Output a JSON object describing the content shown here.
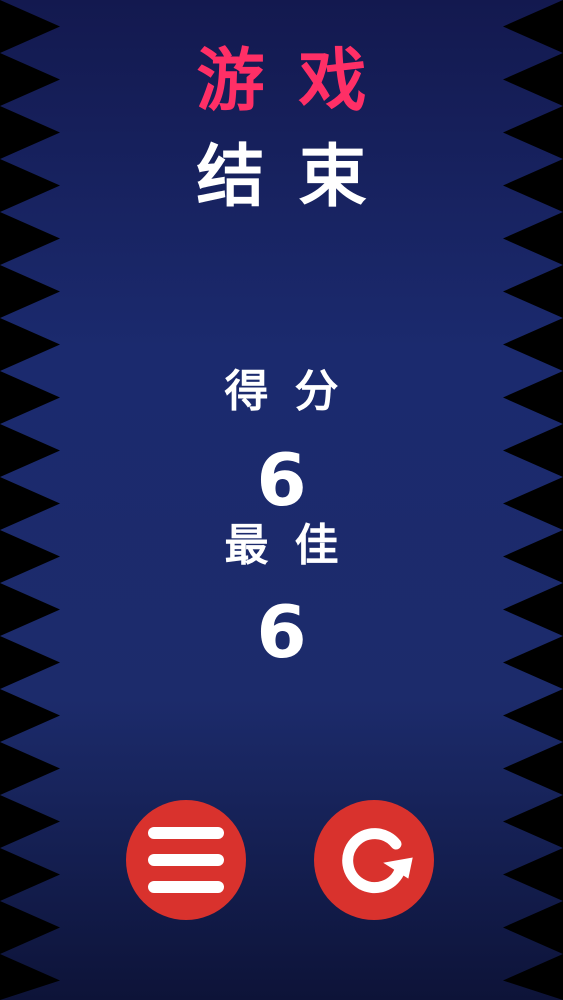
{
  "title": {
    "line1": "游戏",
    "line2": "结束"
  },
  "score": {
    "label": "得分",
    "value": "6"
  },
  "best": {
    "label": "最佳",
    "value": "6"
  },
  "buttons": {
    "menu_icon": "hamburger-menu-icon",
    "restart_icon": "restart-arrow-icon"
  },
  "colors": {
    "background_top": "#13194f",
    "background_mid": "#1c2b6b",
    "spikes": "#000000",
    "title_accent": "#ff2f66",
    "text": "#ffffff",
    "button": "#d9322d"
  }
}
